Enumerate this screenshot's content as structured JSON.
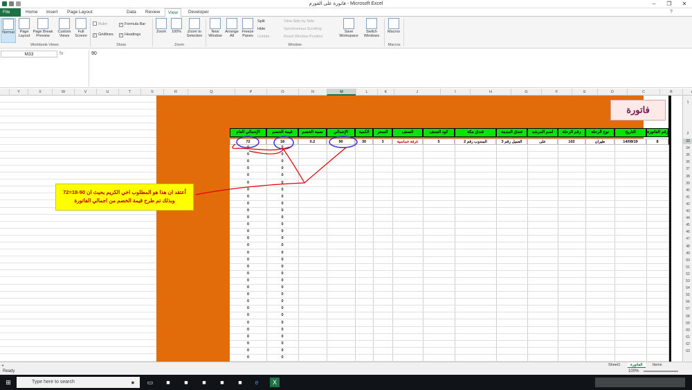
{
  "window": {
    "title": "فاتورة على الفورم - Microsoft Excel"
  },
  "tabs": [
    "File",
    "Home",
    "Insert",
    "Page Layout",
    "Data",
    "Review",
    "View",
    "Developer"
  ],
  "ribbon": {
    "workbook_views": {
      "group": "Workbook Views",
      "normal": "Normal",
      "page_layout": "Page Layout",
      "page_break": "Page Break Preview",
      "custom": "Custom Views",
      "full": "Full Screen"
    },
    "show": {
      "group": "Show",
      "ruler": "Ruler",
      "gridlines": "Gridlines",
      "formula_bar": "Formula Bar",
      "headings": "Headings"
    },
    "zoom": {
      "group": "Zoom",
      "zoom": "Zoom",
      "hundred": "100%",
      "to_selection": "Zoom to Selection"
    },
    "window": {
      "group": "Window",
      "new_window": "New Window",
      "arrange_all": "Arrange All",
      "freeze": "Freeze Panes",
      "split": "Split",
      "hide": "Hide",
      "unhide": "Unhide",
      "side_by_side": "View Side by Side",
      "sync_scroll": "Synchronous Scrolling",
      "reset_pos": "Reset Window Position",
      "save_ws": "Save Workspace",
      "switch": "Switch Windows"
    },
    "macros": {
      "group": "Macros",
      "macros": "Macros"
    }
  },
  "formula_bar": {
    "name_box": "M33",
    "fx": "fx",
    "value": "90"
  },
  "columns": [
    {
      "label": "Y",
      "sel": false
    },
    {
      "label": "X",
      "sel": false
    },
    {
      "label": "W",
      "sel": false
    },
    {
      "label": "V",
      "sel": false
    },
    {
      "label": "U",
      "sel": false
    },
    {
      "label": "T",
      "sel": false
    },
    {
      "label": "S",
      "sel": false
    },
    {
      "label": "R",
      "sel": false
    },
    {
      "label": "Q",
      "sel": false
    },
    {
      "label": "P",
      "sel": false
    },
    {
      "label": "O",
      "sel": false
    },
    {
      "label": "N",
      "sel": false
    },
    {
      "label": "M",
      "sel": true
    },
    {
      "label": "L",
      "sel": false
    },
    {
      "label": "K",
      "sel": false
    },
    {
      "label": "J",
      "sel": false
    },
    {
      "label": "I",
      "sel": false
    },
    {
      "label": "H",
      "sel": false
    },
    {
      "label": "G",
      "sel": false
    },
    {
      "label": "F",
      "sel": false
    },
    {
      "label": "E",
      "sel": false
    },
    {
      "label": "D",
      "sel": false
    },
    {
      "label": "C",
      "sel": false
    },
    {
      "label": "B",
      "sel": false
    },
    {
      "label": "A",
      "sel": false
    }
  ],
  "rows": [
    "1",
    "2",
    "33",
    "34",
    "35",
    "36",
    "37",
    "38",
    "39",
    "40",
    "41",
    "42",
    "43",
    "44",
    "45",
    "46",
    "47",
    "48",
    "49",
    "50",
    "51",
    "52",
    "53",
    "54",
    "55",
    "56",
    "57",
    "58",
    "59",
    "60",
    "61",
    "62",
    "63"
  ],
  "selected_row": "33",
  "invoice_title": "فاتورة",
  "headers": [
    "الإجمالي العام",
    "قيمة الخصم",
    "نسبة الخصم",
    "الإجمالي",
    "الكمية",
    "السعر",
    "الصنف",
    "كود الصنف",
    "فندق مكة",
    "فندق المدينة",
    "اسم المرشد",
    "رقم الرحلة",
    "نوع الرحلة",
    "التاريخ",
    "رقم الفاتورة"
  ],
  "data_row": [
    "72",
    "18",
    "0.2",
    "90",
    "30",
    "3",
    "غرفة خماسية",
    "5",
    "المندوب رقم 2",
    "العميل رقم 3",
    "على",
    "102",
    "طيران",
    "14/08/19",
    "8"
  ],
  "zero_rows": [
    "0",
    "0"
  ],
  "note": {
    "line1": "أعتقد ان هذا هو المطلوب اخي الكريم بحيث ان 90-18=72",
    "line2": "وبذلك تم طرح قيمة الخصم من اجمالي الفاتورة"
  },
  "sheet_tabs": [
    "Sheet1",
    "الفاتورة",
    "Items"
  ],
  "active_sheet": "الفاتورة",
  "status": {
    "ready": "Ready",
    "zoom": "100%"
  },
  "taskbar": {
    "search_placeholder": "Type here to search"
  }
}
